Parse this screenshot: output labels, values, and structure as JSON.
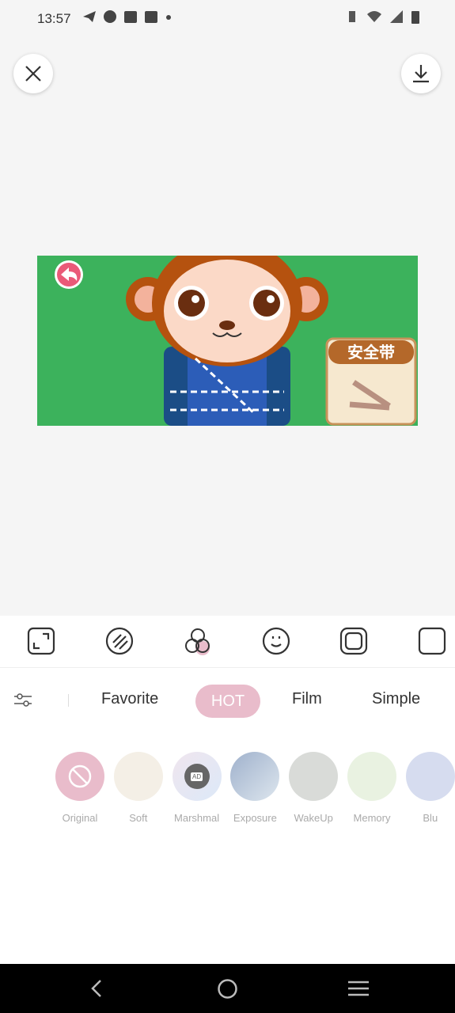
{
  "status_bar": {
    "time": "13:57"
  },
  "top": {
    "close_icon": "close-icon",
    "download_icon": "download-icon"
  },
  "photo": {
    "sign_text": "安全带"
  },
  "tools": [
    "crop-icon",
    "adjust-icon",
    "filter-icon",
    "sticker-icon",
    "frame-icon",
    "more-icon"
  ],
  "categories": {
    "favorite": "Favorite",
    "hot": "HOT",
    "film": "Film",
    "simple": "Simple"
  },
  "filters": [
    {
      "label": "Original",
      "color": "#e9bccb"
    },
    {
      "label": "Soft",
      "color": "#f4efe6"
    },
    {
      "label": "Marshmal",
      "color": "#e6e8f4",
      "badge": "AD"
    },
    {
      "label": "Exposure",
      "color": "#b7c7da"
    },
    {
      "label": "WakeUp",
      "color": "#d9dbd8"
    },
    {
      "label": "Memory",
      "color": "#e9f2e1"
    },
    {
      "label": "Blu",
      "color": "#d6dcef"
    }
  ],
  "accent": "#e9bccb"
}
